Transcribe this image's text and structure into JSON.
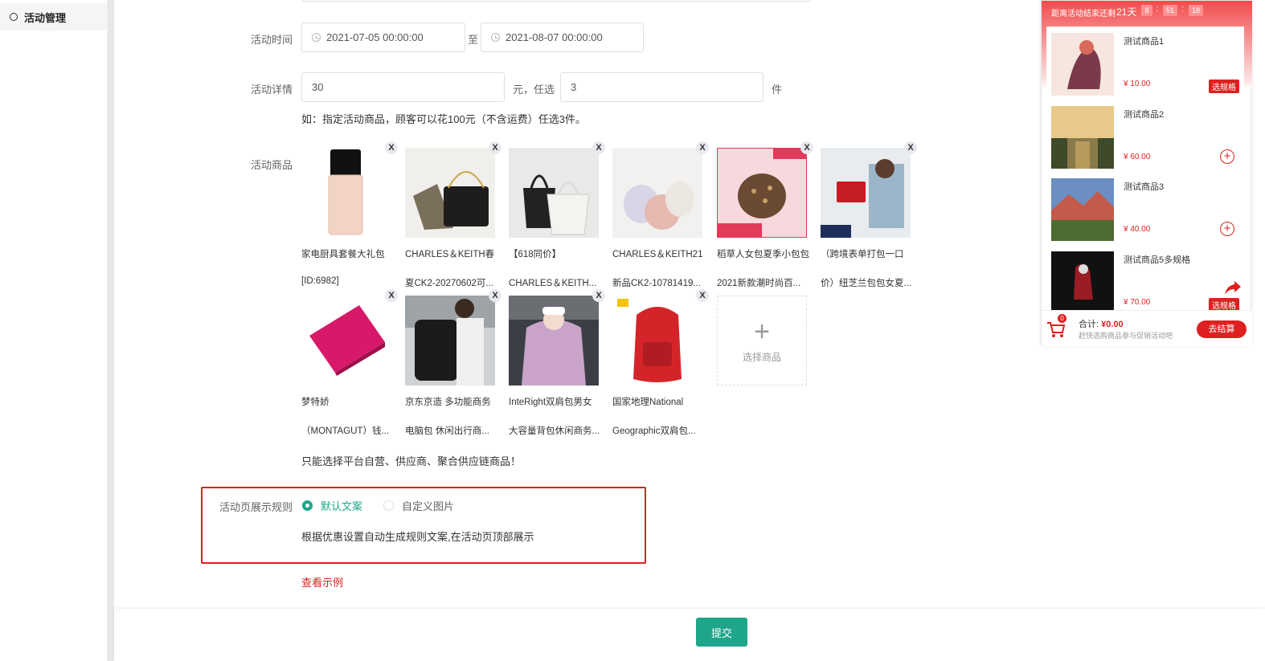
{
  "sidebar": {
    "item_label": "活动管理"
  },
  "form": {
    "time_label": "活动时间",
    "start_time": "2021-07-05 00:00:00",
    "time_sep": "至",
    "end_time": "2021-08-07 00:00:00",
    "detail_label": "活动详情",
    "amount": "30",
    "unit_yuan": "元，任选",
    "count": "3",
    "unit_jian": "件",
    "detail_hint": "如：指定活动商品，顾客可以花100元（不含运费）任选3件。",
    "goods_label": "活动商品",
    "goods_note": "只能选择平台自营、供应商、聚合供应链商品！",
    "select_goods": "选择商品",
    "rule_label": "活动页展示规则",
    "rule_opt1": "默认文案",
    "rule_opt2": "自定义图片",
    "rule_desc": "根据优惠设置自动生成规则文案,在活动页顶部展示",
    "view_example": "查看示例",
    "submit": "提交"
  },
  "products": [
    {
      "line1": "家电厨具套餐大礼包",
      "line2": "[ID:6982]"
    },
    {
      "line1": "CHARLES＆KEITH春",
      "line2": "夏CK2-20270602可..."
    },
    {
      "line1": "【618同价】",
      "line2": "CHARLES＆KEITH..."
    },
    {
      "line1": "CHARLES＆KEITH21",
      "line2": "新品CK2-10781419..."
    },
    {
      "line1": "稻草人女包夏季小包包",
      "line2": "2021新款潮时尚百..."
    },
    {
      "line1": "（跨境表单打包一口",
      "line2": "价）纽芝兰包包女夏..."
    },
    {
      "line1": "梦特娇",
      "line2": "（MONTAGUT）钱..."
    },
    {
      "line1": "京东京造 多功能商务",
      "line2": "电脑包 休闲出行商..."
    },
    {
      "line1": "InteRight双肩包男女",
      "line2": "大容量背包休闲商务..."
    },
    {
      "line1": "国家地理National",
      "line2": "Geographic双肩包..."
    }
  ],
  "preview": {
    "countdown_label": "距离活动结束还剩",
    "days": "21天",
    "hh": "8",
    "mm": "51",
    "ss": "18",
    "items": [
      {
        "name": "测试商品1",
        "price": "¥ 10.00",
        "action": "选规格"
      },
      {
        "name": "测试商品2",
        "price": "¥ 60.00",
        "action": "+"
      },
      {
        "name": "测试商品3",
        "price": "¥ 40.00",
        "action": "+"
      },
      {
        "name": "测试商品5多规格",
        "price": "¥ 70.00",
        "action": "选规格"
      }
    ],
    "cart_count": "0",
    "total_label": "合计:",
    "total_value": "¥0.00",
    "hint": "赶快选购商品参与促销活动吧",
    "checkout": "去结算"
  },
  "colors": {
    "accent": "#1ea58a",
    "danger": "#e02020"
  }
}
